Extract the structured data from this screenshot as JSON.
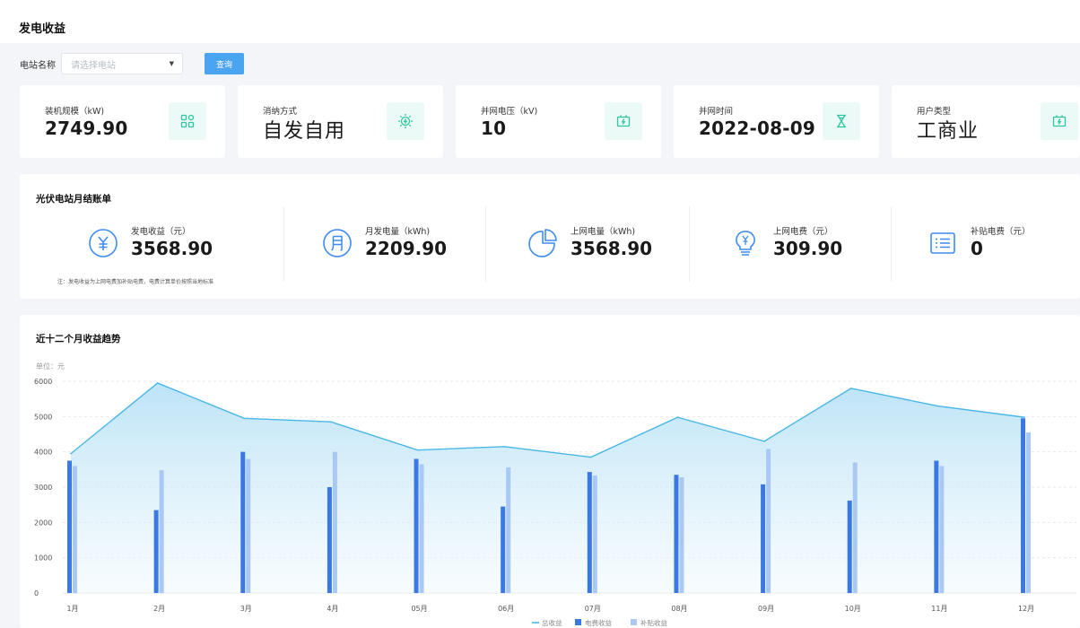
{
  "page": {
    "title": "发电收益"
  },
  "filter": {
    "label": "电站名称",
    "placeholder": "请选择电站",
    "query_button": "查询"
  },
  "cards": [
    {
      "label": "装机规模（kW)",
      "value": "2749.90",
      "icon": "grid-icon"
    },
    {
      "label": "消纳方式",
      "value": "自发自用",
      "icon": "solar-sun-icon"
    },
    {
      "label": "并网电压（kV)",
      "value": "10",
      "icon": "battery-charge-icon"
    },
    {
      "label": "并网时间",
      "value": "2022-08-09",
      "icon": "hourglass-icon"
    },
    {
      "label": "用户类型",
      "value": "工商业",
      "icon": "battery-charge-icon"
    }
  ],
  "bill": {
    "title": "光伏电站月结账单",
    "items": [
      {
        "label": "发电收益（元）",
        "value": "3568.90",
        "icon": "yuan-circle-icon"
      },
      {
        "label": "月发电量（kWh)",
        "value": "2209.90",
        "icon": "month-circle-icon"
      },
      {
        "label": "上网电量（kWh)",
        "value": "3568.90",
        "icon": "pie-icon"
      },
      {
        "label": "上网电费（元）",
        "value": "309.90",
        "icon": "bulb-yuan-icon"
      },
      {
        "label": "补贴电费（元）",
        "value": "0",
        "icon": "list-icon"
      }
    ],
    "note": "注：发电收益为上网电费加补贴电费，电费计算单价按照当地标准"
  },
  "trend": {
    "title": "近十二个月收益趋势",
    "unit": "单位：元"
  },
  "colors": {
    "accent": "#4aa4f0",
    "icon_green": "#2ec6a0",
    "icon_blue": "#3d8bf5",
    "bar_dark": "#3a79e3",
    "bar_light": "#a9c8f4",
    "line": "#49b7e5"
  },
  "chart_data": {
    "type": "bar",
    "categories": [
      "1月",
      "2月",
      "3月",
      "4月",
      "05月",
      "06月",
      "07月",
      "08月",
      "09月",
      "10月",
      "11月",
      "12月"
    ],
    "ylim": [
      0,
      6000
    ],
    "yticks": [
      0,
      1000,
      2000,
      3000,
      4000,
      5000,
      6000
    ],
    "grid": true,
    "legend_position": "bottom",
    "series": [
      {
        "name": "电费收益",
        "type": "bar",
        "values": [
          3750,
          2350,
          4000,
          3000,
          3800,
          2450,
          3430,
          3350,
          3080,
          2620,
          3750,
          4950
        ]
      },
      {
        "name": "补贴收益",
        "type": "bar",
        "values": [
          3600,
          3480,
          3800,
          4000,
          3650,
          3560,
          3330,
          3280,
          4080,
          3700,
          3600,
          4550
        ]
      },
      {
        "name": "总收益",
        "type": "area",
        "values": [
          3950,
          5950,
          4950,
          4850,
          4050,
          4150,
          3850,
          4980,
          4300,
          5800,
          5300,
          4980
        ]
      }
    ]
  }
}
